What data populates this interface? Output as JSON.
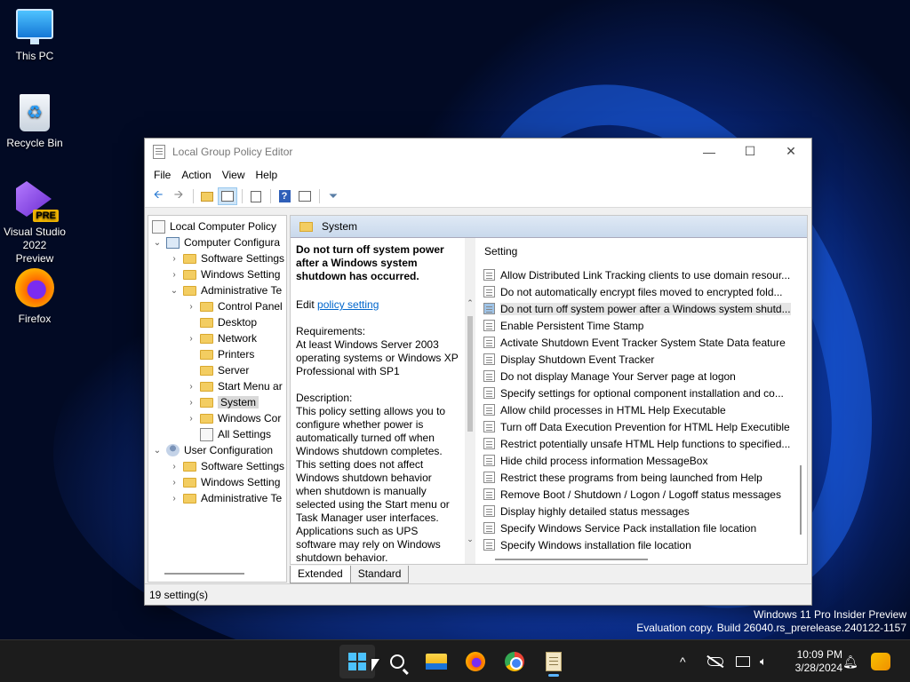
{
  "desktop": {
    "icons": [
      {
        "label": "This PC"
      },
      {
        "label": "Recycle Bin"
      },
      {
        "label": "Visual Studio 2022 Preview",
        "badge": "PRE"
      },
      {
        "label": "Firefox"
      }
    ]
  },
  "window": {
    "title": "Local Group Policy Editor",
    "controls": {
      "minimize": "—",
      "maximize": "☐",
      "close": "✕"
    },
    "menu": [
      "File",
      "Action",
      "View",
      "Help"
    ],
    "toolbar_icons": [
      "back-arrow-icon",
      "forward-arrow-icon",
      "up-folder-icon",
      "show-hide-tree-icon",
      "export-list-icon",
      "help-icon",
      "properties-icon",
      "filter-icon"
    ],
    "tree": [
      {
        "label": "Local Computer Policy",
        "expander": "",
        "icon": "policy"
      },
      {
        "label": "Computer Configura",
        "expander": "⌄",
        "icon": "computer"
      },
      {
        "label": "Software Settings",
        "expander": "›",
        "icon": "folder"
      },
      {
        "label": "Windows Setting",
        "expander": "›",
        "icon": "folder"
      },
      {
        "label": "Administrative Te",
        "expander": "⌄",
        "icon": "folder"
      },
      {
        "label": "Control Panel",
        "expander": "›",
        "icon": "folder"
      },
      {
        "label": "Desktop",
        "expander": "",
        "icon": "folder"
      },
      {
        "label": "Network",
        "expander": "›",
        "icon": "folder"
      },
      {
        "label": "Printers",
        "expander": "",
        "icon": "folder"
      },
      {
        "label": "Server",
        "expander": "",
        "icon": "folder"
      },
      {
        "label": "Start Menu ar",
        "expander": "›",
        "icon": "folder"
      },
      {
        "label": "System",
        "expander": "›",
        "icon": "folder",
        "selected": true
      },
      {
        "label": "Windows Cor",
        "expander": "›",
        "icon": "folder"
      },
      {
        "label": "All Settings",
        "expander": "",
        "icon": "settings"
      },
      {
        "label": "User Configuration",
        "expander": "⌄",
        "icon": "user"
      },
      {
        "label": "Software Settings",
        "expander": "›",
        "icon": "folder"
      },
      {
        "label": "Windows Setting",
        "expander": "›",
        "icon": "folder"
      },
      {
        "label": "Administrative Te",
        "expander": "›",
        "icon": "folder"
      }
    ],
    "right_header": "System",
    "extended": {
      "title": "Do not turn off system power after a Windows system shutdown has occurred.",
      "edit_prefix": "Edit ",
      "edit_link": "policy setting",
      "requirements_label": "Requirements:",
      "requirements": "At least Windows Server 2003 operating systems or Windows XP Professional with SP1",
      "description_label": "Description:",
      "description": "This policy setting allows you to configure whether power is automatically turned off when Windows shutdown completes. This setting does not affect Windows shutdown behavior when shutdown is manually selected using the Start menu or Task Manager user interfaces. Applications such as UPS software may rely on Windows shutdown behavior."
    },
    "list_header": "Setting",
    "settings": [
      "Allow Distributed Link Tracking clients to use domain resour...",
      "Do not automatically encrypt files moved to encrypted fold...",
      "Do not turn off system power after a Windows system shutd...",
      "Enable Persistent Time Stamp",
      "Activate Shutdown Event Tracker System State Data feature",
      "Display Shutdown Event Tracker",
      "Do not display Manage Your Server page at logon",
      "Specify settings for optional component installation and co...",
      "Allow child processes in HTML Help Executable",
      "Turn off Data Execution Prevention for HTML Help Executible",
      "Restrict potentially unsafe HTML Help functions to specified...",
      "Hide child process information MessageBox",
      "Restrict these programs from being launched from Help",
      "Remove Boot / Shutdown / Logon / Logoff status messages",
      "Display highly detailed status messages",
      "Specify Windows Service Pack installation file location",
      "Specify Windows installation file location"
    ],
    "highlighted_setting_index": 2,
    "tabs": [
      "Extended",
      "Standard"
    ],
    "status": "19 setting(s)"
  },
  "watermark": {
    "line1": "Windows 11 Pro Insider Preview",
    "line2": "Evaluation copy. Build 26040.rs_prerelease.240122-1157"
  },
  "taskbar": {
    "apps": [
      "start-icon",
      "search-icon",
      "file-explorer-icon",
      "firefox-icon",
      "chrome-icon",
      "group-policy-editor-icon"
    ],
    "tray": {
      "chevron": "^",
      "time": "10:09 PM",
      "date": "3/28/2024"
    }
  }
}
